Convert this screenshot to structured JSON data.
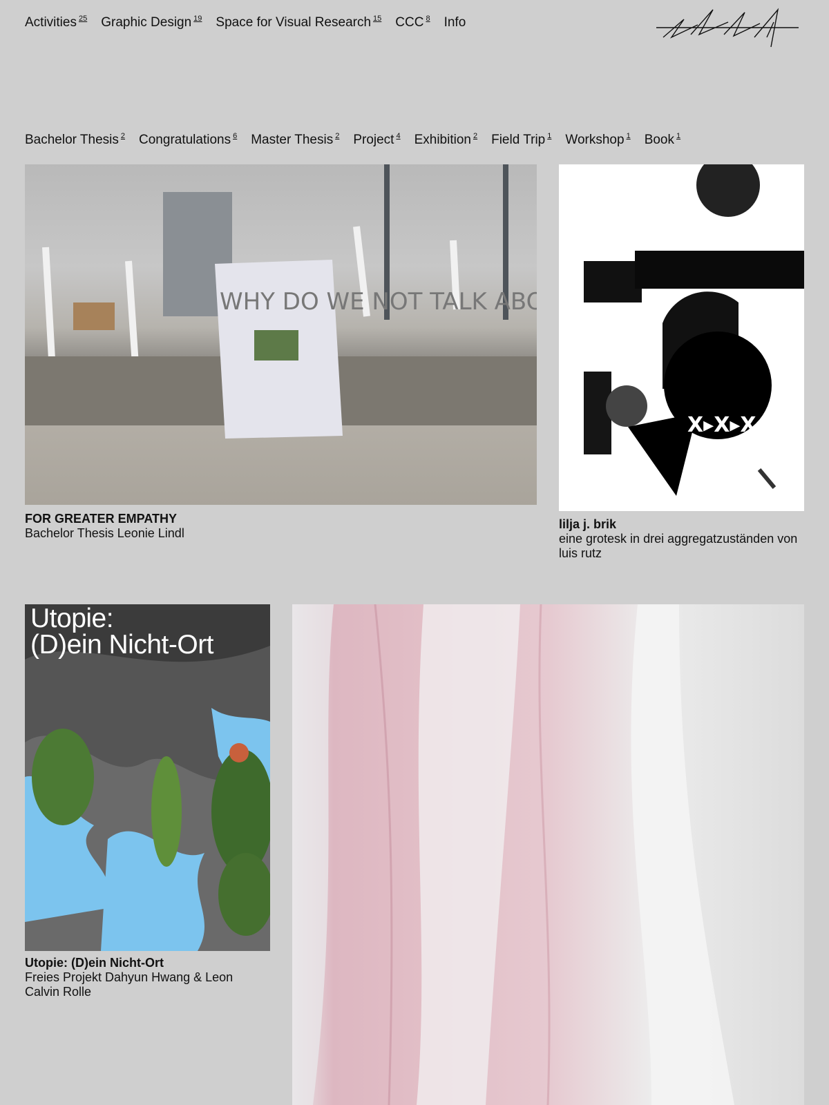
{
  "top_nav": [
    {
      "label": "Activities",
      "count": "25"
    },
    {
      "label": "Graphic Design",
      "count": "19"
    },
    {
      "label": "Space for Visual Research",
      "count": "15"
    },
    {
      "label": "CCC",
      "count": "8"
    },
    {
      "label": "Info",
      "count": ""
    }
  ],
  "filters": [
    {
      "label": "Bachelor Thesis",
      "count": "2"
    },
    {
      "label": "Congratulations",
      "count": "6"
    },
    {
      "label": "Master Thesis",
      "count": "2"
    },
    {
      "label": "Project",
      "count": "4"
    },
    {
      "label": "Exhibition",
      "count": "2"
    },
    {
      "label": "Field Trip",
      "count": "1"
    },
    {
      "label": "Workshop",
      "count": "1"
    },
    {
      "label": "Book",
      "count": "1"
    }
  ],
  "cards": [
    {
      "title": "FOR GREATER EMPATHY",
      "subtitle": "Bachelor Thesis Leonie Lindl",
      "sign_text": "WHY DO WE NOT TALK ABOUT IT?"
    },
    {
      "title": "lilja j. brik",
      "subtitle": "eine grotesk in drei aggregatzuständen von luis rutz"
    },
    {
      "title": "Utopie: (D)ein Nicht-Ort",
      "subtitle": "Freies Projekt Dahyun Hwang & Leon Calvin Rolle",
      "poster_text": "Utopie:\n(D)ein Nicht-Ort"
    },
    {
      "title": "",
      "subtitle": ""
    }
  ]
}
